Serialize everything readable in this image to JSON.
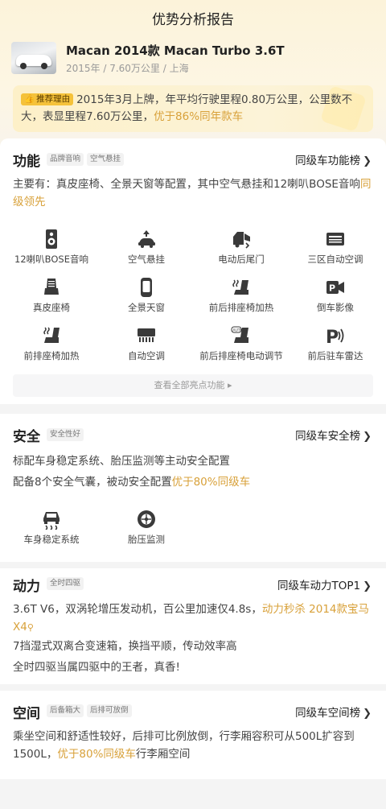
{
  "page_title": "优势分析报告",
  "car": {
    "name": "Macan 2014款 Macan Turbo 3.6T",
    "meta": "2015年 / 7.60万公里 / 上海"
  },
  "recommend": {
    "badge": "推荐理由",
    "text": "2015年3月上牌，年平均行驶里程0.80万公里，公里数不大，表显里程7.60万公里，",
    "highlight": "优于86%同年款车"
  },
  "function": {
    "title": "功能",
    "tags": [
      "品牌音响",
      "空气悬挂"
    ],
    "rank_label": "同级车功能榜",
    "desc": "主要有：真皮座椅、全景天窗等配置，其中空气悬挂和12喇叭BOSE音响",
    "desc_highlight": "同级领先",
    "features": [
      {
        "label": "12喇叭BOSE音响",
        "icon": "speaker-icon"
      },
      {
        "label": "空气悬挂",
        "icon": "air-suspension-icon"
      },
      {
        "label": "电动后尾门",
        "icon": "power-tailgate-icon"
      },
      {
        "label": "三区自动空调",
        "icon": "climate-control-icon"
      },
      {
        "label": "真皮座椅",
        "icon": "leather-seat-icon"
      },
      {
        "label": "全景天窗",
        "icon": "panoramic-sunroof-icon"
      },
      {
        "label": "前后排座椅加热",
        "icon": "seat-heating-icon"
      },
      {
        "label": "倒车影像",
        "icon": "rear-camera-icon"
      },
      {
        "label": "前排座椅加热",
        "icon": "front-seat-heating-icon"
      },
      {
        "label": "自动空调",
        "icon": "auto-ac-icon"
      },
      {
        "label": "前后排座椅电动调节",
        "icon": "power-seat-icon"
      },
      {
        "label": "前后驻车雷达",
        "icon": "parking-radar-icon"
      }
    ],
    "view_all": "查看全部亮点功能"
  },
  "safety": {
    "title": "安全",
    "tag": "安全性好",
    "rank_label": "同级车安全榜",
    "line1": "标配车身稳定系统、胎压监测等主动安全配置",
    "line2": "配备8个安全气囊，被动安全配置",
    "line2_highlight": "优于80%同级车",
    "features": [
      {
        "label": "车身稳定系统",
        "icon": "stability-control-icon"
      },
      {
        "label": "胎压监测",
        "icon": "tire-pressure-icon"
      }
    ]
  },
  "power": {
    "title": "动力",
    "tag": "全时四驱",
    "rank_label": "同级车动力TOP1",
    "line1": "3.6T V6，双涡轮增压发动机，百公里加速仅4.8s，",
    "line1_highlight": "动力秒杀 2014款宝马X4",
    "line2": "7挡湿式双离合变速箱，换挡平顺，传动效率高",
    "line3": "全时四驱当属四驱中的王者，真香!"
  },
  "space": {
    "title": "空间",
    "tags": [
      "后备箱大",
      "后排可放倒"
    ],
    "rank_label": "同级车空间榜",
    "line": "乘坐空间和舒适性较好，后排可比例放倒，行李厢容积可从500L扩容到1500L，",
    "highlight": "优于80%同级车",
    "line_tail": "行李厢空间"
  },
  "colors": {
    "accent": "#d8a13a",
    "badge": "#f5c23a",
    "icon": "#3a3a3a"
  }
}
